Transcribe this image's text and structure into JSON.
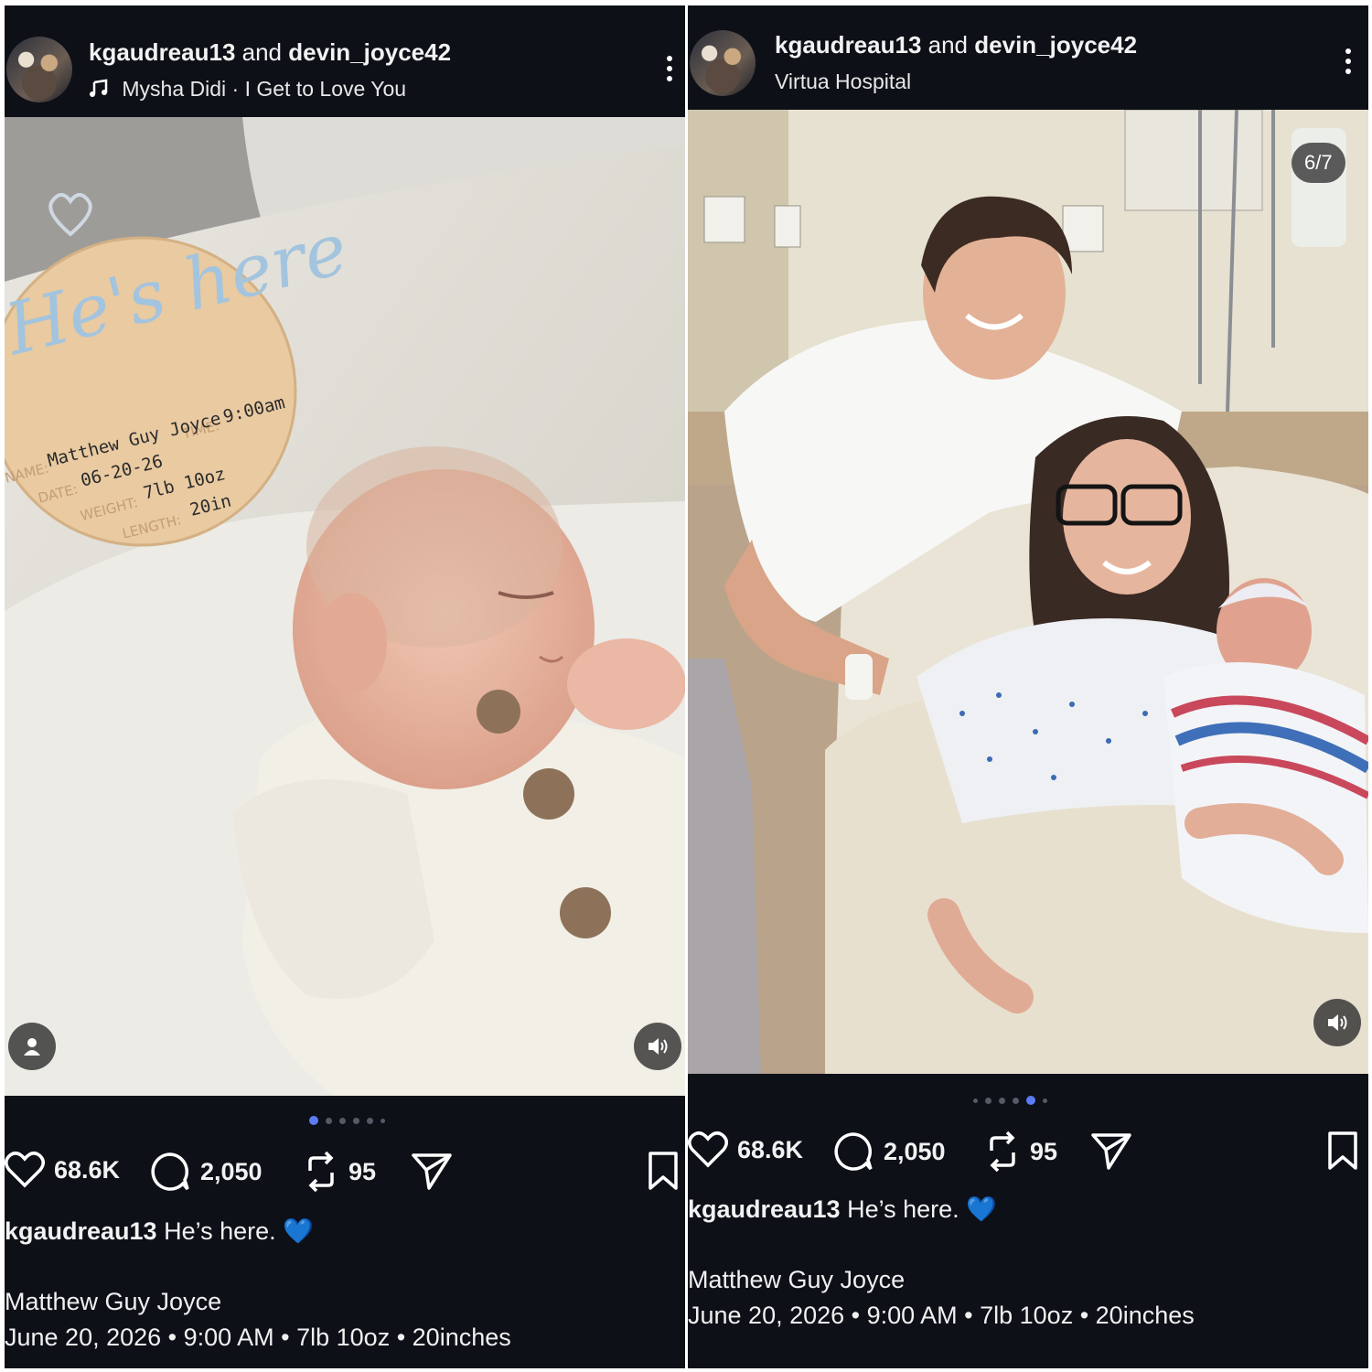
{
  "post": {
    "author_primary": "kgaudreau13",
    "and_word": "and",
    "author_secondary": "devin_joyce42",
    "likes": "68.6K",
    "comments": "2,050",
    "reposts": "95",
    "caption_user": "kgaudreau13",
    "caption_text": "He’s here.",
    "caption_emoji": "💙",
    "baby_name": "Matthew Guy Joyce",
    "birth_details": "June 20, 2026 • 9:00 AM • 7lb 10oz • 20inches"
  },
  "left": {
    "music_track": "Mysha Didi · I Get to Love You",
    "slide_count": 6,
    "active_slide": 1,
    "sign": {
      "headline": "He's here",
      "name_label": "NAME:",
      "name_value": "Matthew Guy Joyce",
      "time_label": "TIME:",
      "time_value": "9:00am",
      "date_label": "DATE:",
      "date_value": "06-20-26",
      "weight_label": "WEIGHT:",
      "weight_value": "7lb 10oz",
      "length_label": "LENGTH:",
      "length_value": "20in"
    }
  },
  "right": {
    "location": "Virtua Hospital",
    "slide_indicator": "6/7",
    "slide_count": 6,
    "active_slide": 5
  },
  "colors": {
    "background": "#0d1017",
    "accent_dot": "#5b7cf4",
    "heart_emoji": "#2f8ef0"
  },
  "icons": [
    "music-icon",
    "more-icon",
    "heart-icon",
    "comment-icon",
    "repost-icon",
    "share-icon",
    "bookmark-icon",
    "user-icon",
    "sound-icon"
  ]
}
